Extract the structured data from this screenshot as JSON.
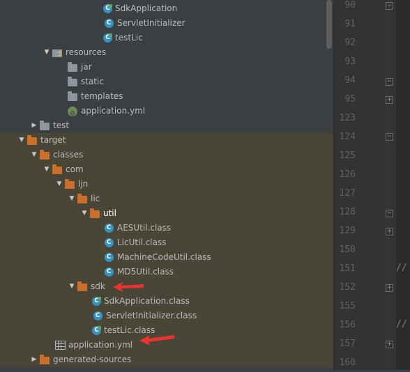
{
  "tree": [
    {
      "label": "SdkApplication",
      "icon": "class-run-icon",
      "arrow": ""
    },
    {
      "label": "ServletInitializer",
      "icon": "class-icon",
      "arrow": ""
    },
    {
      "label": "testLic",
      "icon": "class-run-icon",
      "arrow": ""
    },
    {
      "label": "resources",
      "icon": "resources-folder-icon",
      "arrow": "down"
    },
    {
      "label": "jar",
      "icon": "folder-icon",
      "arrow": ""
    },
    {
      "label": "static",
      "icon": "folder-icon",
      "arrow": ""
    },
    {
      "label": "templates",
      "icon": "folder-icon",
      "arrow": ""
    },
    {
      "label": "application.yml",
      "icon": "spring-yml-icon",
      "arrow": ""
    },
    {
      "label": "test",
      "icon": "folder-icon",
      "arrow": "right"
    },
    {
      "label": "target",
      "icon": "folder-orange-icon",
      "arrow": "down"
    },
    {
      "label": "classes",
      "icon": "folder-orange-icon",
      "arrow": "down"
    },
    {
      "label": "com",
      "icon": "folder-orange-icon",
      "arrow": "down"
    },
    {
      "label": "ljn",
      "icon": "folder-orange-icon",
      "arrow": "down"
    },
    {
      "label": "lic",
      "icon": "folder-orange-icon",
      "arrow": "down"
    },
    {
      "label": "util",
      "icon": "folder-orange-icon",
      "arrow": "down"
    },
    {
      "label": "AESUtil.class",
      "icon": "class-icon",
      "arrow": ""
    },
    {
      "label": "LicUtil.class",
      "icon": "class-icon",
      "arrow": ""
    },
    {
      "label": "MachineCodeUtil.class",
      "icon": "class-icon",
      "arrow": ""
    },
    {
      "label": "MD5Util.class",
      "icon": "class-icon",
      "arrow": ""
    },
    {
      "label": "sdk",
      "icon": "folder-orange-icon",
      "arrow": "down"
    },
    {
      "label": "SdkApplication.class",
      "icon": "class-run-icon",
      "arrow": ""
    },
    {
      "label": "ServletInitializer.class",
      "icon": "class-icon",
      "arrow": ""
    },
    {
      "label": "testLic.class",
      "icon": "class-run-icon",
      "arrow": ""
    },
    {
      "label": "application.yml",
      "icon": "grid-file-icon",
      "arrow": ""
    },
    {
      "label": "generated-sources",
      "icon": "folder-orange-icon",
      "arrow": "right"
    }
  ],
  "selected_row": "util",
  "line_numbers": [
    "90",
    "91",
    "92",
    "93",
    "94",
    "95",
    "123",
    "124",
    "125",
    "126",
    "127",
    "128",
    "129",
    "150",
    "151",
    "152",
    "155",
    "156",
    "157",
    "160"
  ],
  "editor_comments": [
    "//",
    "//"
  ],
  "colors": {
    "selection": "#4b6eaf",
    "excluded_band": "#4a4637",
    "annotation_arrow": "#e8342c"
  }
}
